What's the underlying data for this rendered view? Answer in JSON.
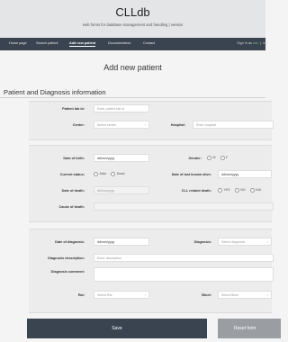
{
  "header": {
    "title": "CLLdb",
    "subtitle": "web forms for database management and handling | version"
  },
  "nav": {
    "items": [
      "Home page",
      "Search patient",
      "Add new patient",
      "Documentation",
      "Contact"
    ],
    "signed_in_prefix": "Sign in as",
    "user": "xxx",
    "separator": "|",
    "right_item": "log"
  },
  "page": {
    "heading": "Add new patient",
    "section_title": "Patient and Diagnosis information"
  },
  "form": {
    "patient_id": {
      "label": "Patient lab id:",
      "placeholder": "Enter patient lab id"
    },
    "center": {
      "label": "Center:",
      "placeholder": "Select center"
    },
    "hospital": {
      "label": "Hospital:",
      "placeholder": "Enter hospital"
    },
    "dob": {
      "label": "Date of birth:",
      "value": "dd/mm/yyyy"
    },
    "gender": {
      "label": "Gender:",
      "options": [
        "M",
        "F"
      ]
    },
    "current_status": {
      "label": "Current status:",
      "options": [
        "Alive",
        "Dead"
      ]
    },
    "last_known_alive": {
      "label": "Date of last known alive:",
      "value": "dd/mm/yyyy"
    },
    "date_of_death": {
      "label": "Date of death:",
      "placeholder": "dd/mm/yyyy"
    },
    "cll_related_death": {
      "label": "CLL related death:",
      "options": [
        "YES",
        "NO",
        "N/A"
      ]
    },
    "cause_of_death": {
      "label": "Cause of death:"
    },
    "date_of_diagnosis": {
      "label": "Date of diagnosis:",
      "value": "dd/mm/yyyy"
    },
    "diagnosis": {
      "label": "Diagnosis:",
      "placeholder": "Select diagnosis"
    },
    "diagnosis_description": {
      "label": "Diagnosis description:",
      "placeholder": "Enter description"
    },
    "diagnosis_comment": {
      "label": "Diagnosis comment:"
    },
    "rai": {
      "label": "Rai:",
      "placeholder": "Select Rai"
    },
    "binet": {
      "label": "Binet:",
      "placeholder": "Select Binet"
    }
  },
  "buttons": {
    "save": "Save",
    "reset": "Reset form"
  },
  "colors": {
    "navbar": "#3a4451",
    "header_bg": "#e4e5e6",
    "user_green": "#6fd07b",
    "reset_bg": "#9a9ea3"
  }
}
